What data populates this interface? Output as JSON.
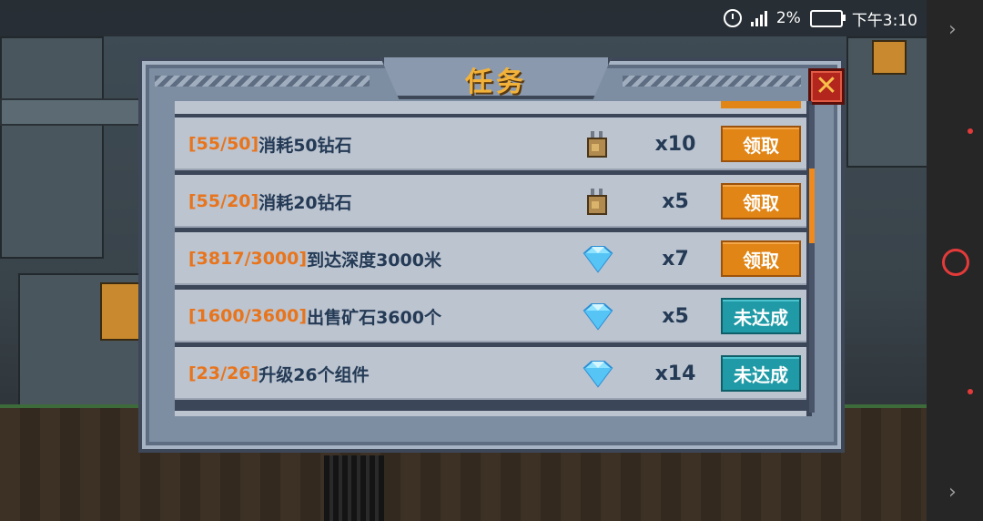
{
  "status_bar": {
    "battery_percent": "2%",
    "time": "下午3:10"
  },
  "dialog": {
    "title": "任务",
    "close_label": "✕"
  },
  "tasks": [
    {
      "progress": "[55/50]",
      "description": "消耗50钻石",
      "reward_icon": "backpack-icon",
      "amount": "x10",
      "button": "领取",
      "state": "claimable"
    },
    {
      "progress": "[55/20]",
      "description": "消耗20钻石",
      "reward_icon": "backpack-icon",
      "amount": "x5",
      "button": "领取",
      "state": "claimable"
    },
    {
      "progress": "[3817/3000]",
      "description": "到达深度3000米",
      "reward_icon": "diamond-icon",
      "amount": "x7",
      "button": "领取",
      "state": "claimable"
    },
    {
      "progress": "[1600/3600]",
      "description": "出售矿石3600个",
      "reward_icon": "diamond-icon",
      "amount": "x5",
      "button": "未达成",
      "state": "locked"
    },
    {
      "progress": "[23/26]",
      "description": "升级26个组件",
      "reward_icon": "diamond-icon",
      "amount": "x14",
      "button": "未达成",
      "state": "locked"
    }
  ],
  "colors": {
    "progress_text": "#e8741c",
    "task_text": "#243a55",
    "claim_button": "#e08516",
    "locked_button": "#1f9aa6",
    "title": "#f2b23a"
  }
}
